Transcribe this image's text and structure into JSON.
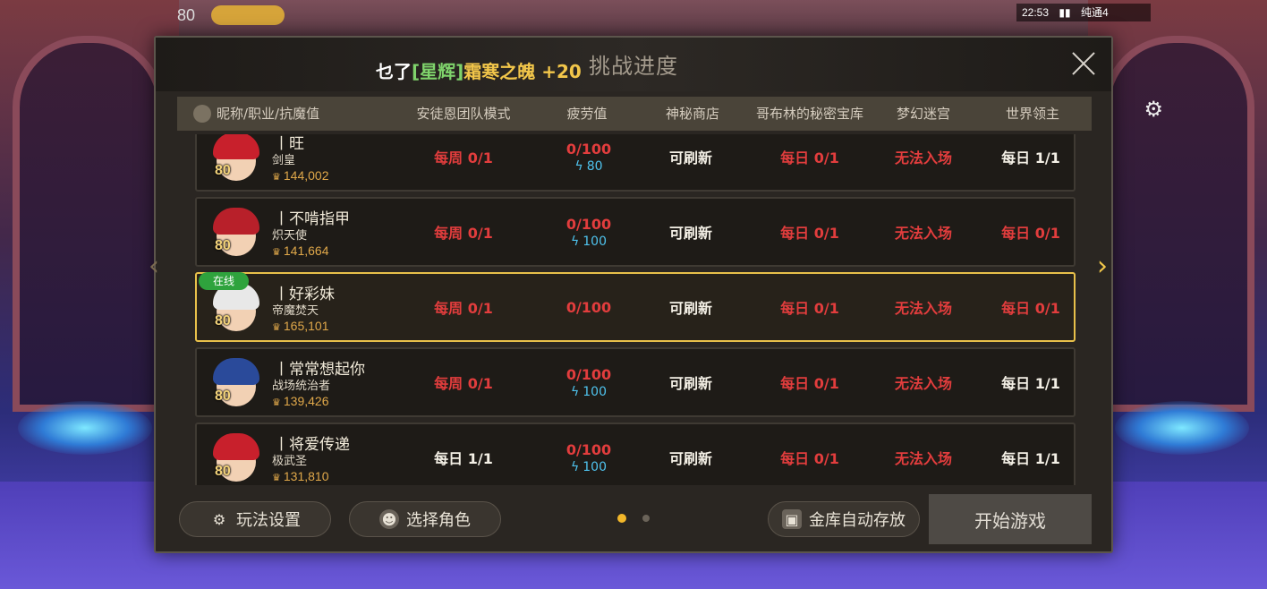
{
  "hud": {
    "level": "80",
    "clock": "22:53",
    "status_extra": "纯通4"
  },
  "modal": {
    "title": "挑战进度",
    "marquee": {
      "prefix": "乜了",
      "bracket": "[星辉]",
      "item": "霜寒之魄",
      "plus": " +20"
    }
  },
  "columns": {
    "name": "昵称/职业/抗魔值",
    "anton": "安徒恩团队模式",
    "fatigue": "疲劳值",
    "shop": "神秘商店",
    "goblin": "哥布林的秘密宝库",
    "maze": "梦幻迷宫",
    "boss": "世界领主"
  },
  "rows": [
    {
      "level": "80",
      "name": "丨旺",
      "class": "剑皇",
      "power": "144,002",
      "online": "",
      "anton": "每周 0/1",
      "anton_color": "red",
      "fatigue": "0/100",
      "fatigue_sub": "80",
      "shop": "可刷新",
      "goblin": "每日 0/1",
      "maze": "无法入场",
      "boss": "每日 1/1",
      "boss_color": "white",
      "hair": "#c8202c",
      "selected": false
    },
    {
      "level": "80",
      "name": "丨不啃指甲",
      "class": "炽天使",
      "power": "141,664",
      "online": "",
      "anton": "每周 0/1",
      "anton_color": "red",
      "fatigue": "0/100",
      "fatigue_sub": "100",
      "shop": "可刷新",
      "goblin": "每日 0/1",
      "maze": "无法入场",
      "boss": "每日 0/1",
      "boss_color": "red",
      "hair": "#b8202a",
      "selected": false
    },
    {
      "level": "80",
      "name": "丨好彩妹",
      "class": "帝魔焚天",
      "power": "165,101",
      "online": "在线",
      "anton": "每周 0/1",
      "anton_color": "red",
      "fatigue": "0/100",
      "fatigue_sub": "",
      "shop": "可刷新",
      "goblin": "每日 0/1",
      "maze": "无法入场",
      "boss": "每日 0/1",
      "boss_color": "red",
      "hair": "#e8e8e8",
      "selected": true
    },
    {
      "level": "80",
      "name": "丨常常想起你",
      "class": "战场统治者",
      "power": "139,426",
      "online": "",
      "anton": "每周 0/1",
      "anton_color": "red",
      "fatigue": "0/100",
      "fatigue_sub": "100",
      "shop": "可刷新",
      "goblin": "每日 0/1",
      "maze": "无法入场",
      "boss": "每日 1/1",
      "boss_color": "white",
      "hair": "#2a4a9a",
      "selected": false
    },
    {
      "level": "80",
      "name": "丨将爱传递",
      "class": "极武圣",
      "power": "131,810",
      "online": "",
      "anton": "每日 1/1",
      "anton_color": "white",
      "fatigue": "0/100",
      "fatigue_sub": "100",
      "shop": "可刷新",
      "goblin": "每日 0/1",
      "maze": "无法入场",
      "boss": "每日 1/1",
      "boss_color": "white",
      "hair": "#c8202c",
      "selected": false
    }
  ],
  "footer": {
    "settings": "玩法设置",
    "select_role": "选择角色",
    "auto_store": "金库自动存放",
    "start": "开始游戏",
    "page_current": 1,
    "page_total": 2
  },
  "colors": {
    "accent_gold": "#f2b72a",
    "red": "#e23d3d",
    "fatigue_blue": "#4fc3ee",
    "online_green": "#2fa33d"
  }
}
